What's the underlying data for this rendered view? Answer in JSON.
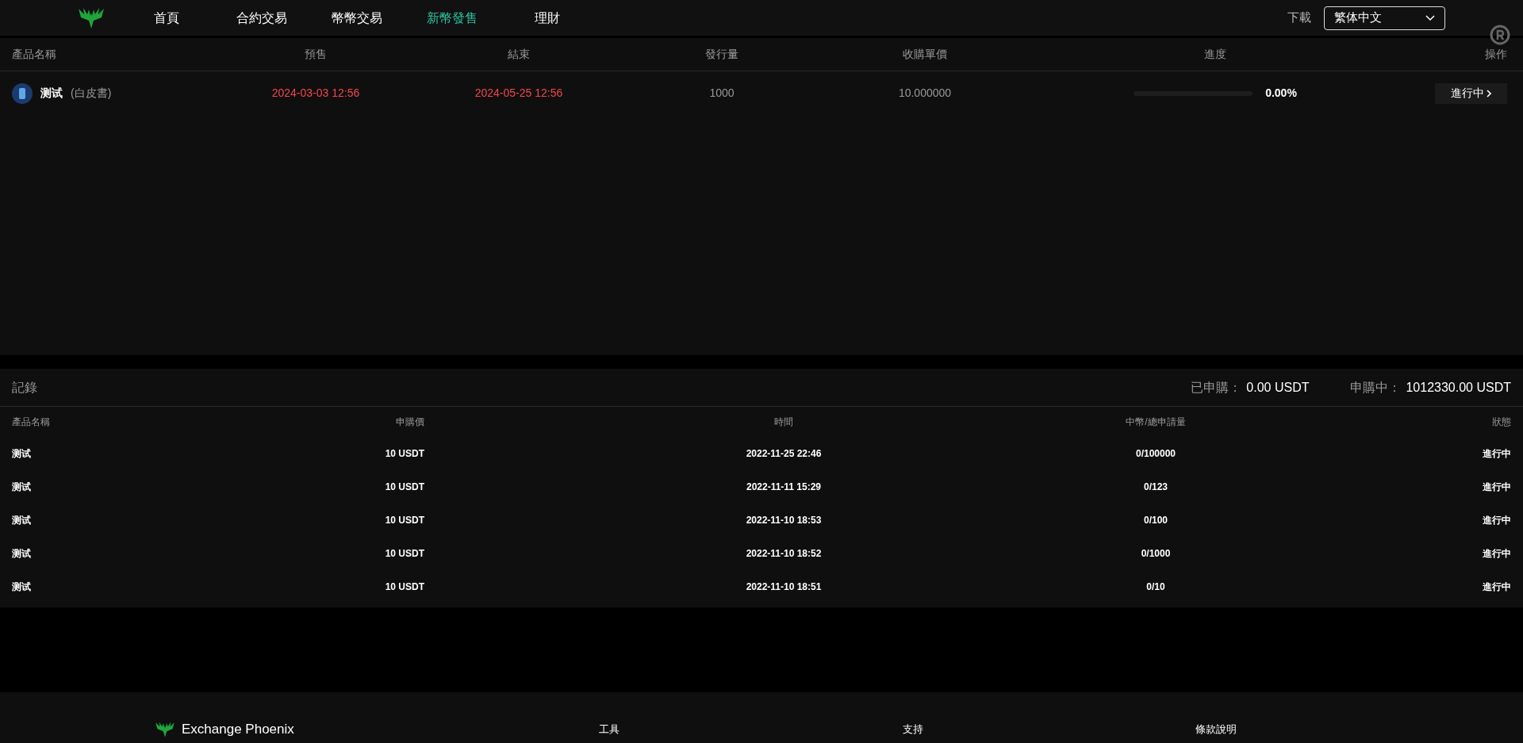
{
  "nav": {
    "items": [
      {
        "label": "首頁",
        "selected": false
      },
      {
        "label": "合約交易",
        "selected": false
      },
      {
        "label": "幣幣交易",
        "selected": false
      },
      {
        "label": "新幣發售",
        "selected": true
      },
      {
        "label": "理財",
        "selected": false
      }
    ],
    "download": "下載",
    "language": "繁体中文"
  },
  "offerings": {
    "columns": [
      "產品名稱",
      "預售",
      "結束",
      "發行量",
      "收購單價",
      "進度",
      "操作"
    ],
    "rows": [
      {
        "name": "测试",
        "note": "(白皮書)",
        "presale": "2024-03-03 12:56",
        "end": "2024-05-25 12:56",
        "issued": "1000",
        "price": "10.000000",
        "progress": {
          "level": 0,
          "reading": "0.00%"
        },
        "action": "進行中"
      }
    ]
  },
  "records": {
    "title": "記錄",
    "summary": [
      {
        "label": "已申購：",
        "value": "0.00 USDT"
      },
      {
        "label": "申購中：",
        "value": "1012330.00 USDT"
      }
    ],
    "columns": [
      "產品名稱",
      "申購價",
      "時間",
      "中幣/總申請量",
      "狀態"
    ],
    "rows": [
      {
        "name": "测试",
        "price": "10 USDT",
        "time": "2022-11-25 22:46",
        "ratio": "0/100000",
        "status": "進行中"
      },
      {
        "name": "测试",
        "price": "10 USDT",
        "time": "2022-11-11 15:29",
        "ratio": "0/123",
        "status": "進行中"
      },
      {
        "name": "测试",
        "price": "10 USDT",
        "time": "2022-11-10 18:53",
        "ratio": "0/100",
        "status": "進行中"
      },
      {
        "name": "测试",
        "price": "10 USDT",
        "time": "2022-11-10 18:52",
        "ratio": "0/1000",
        "status": "進行中"
      },
      {
        "name": "测试",
        "price": "10 USDT",
        "time": "2022-11-10 18:51",
        "ratio": "0/10",
        "status": "進行中"
      }
    ]
  },
  "footer": {
    "brand": "Exchange Phoenix",
    "links": [
      "工具",
      "支持",
      "條款說明"
    ]
  }
}
